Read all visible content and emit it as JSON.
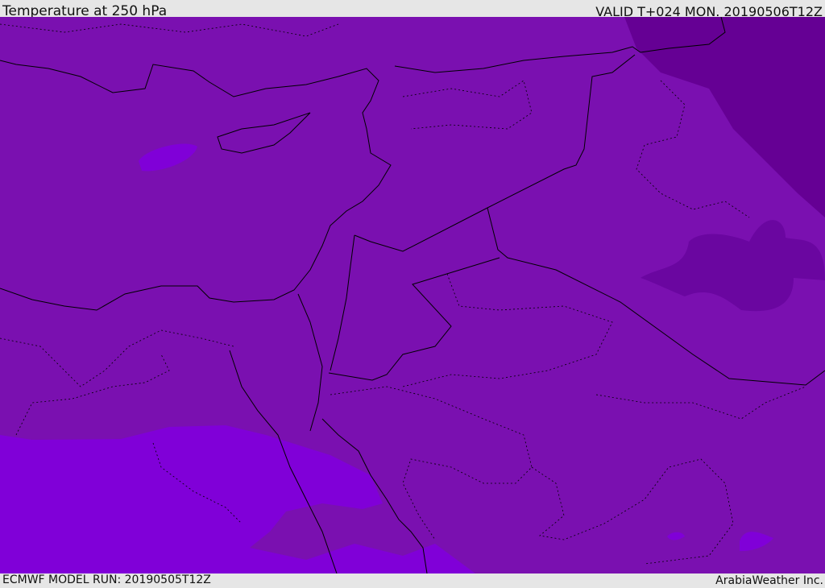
{
  "header": {
    "title": "Temperature at 250 hPa",
    "valid": "VALID T+024 MON. 20190506T12Z"
  },
  "footer": {
    "model_run": "ECMWF MODEL RUN: 20190505T12Z",
    "credit": "ArabiaWeather Inc."
  },
  "colors": {
    "base": "#7a10b0",
    "warm": "#8000d8",
    "cold": "#650094",
    "colder": "#6a06a0",
    "border": "#000000"
  }
}
